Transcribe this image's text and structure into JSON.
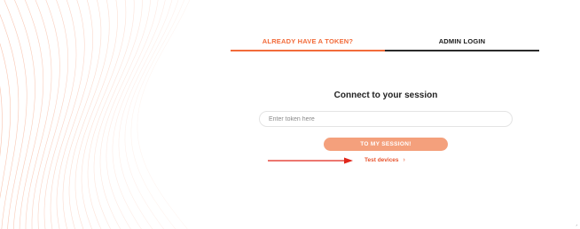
{
  "tabs": {
    "token_label": "ALREADY HAVE A TOKEN?",
    "admin_label": "ADMIN LOGIN"
  },
  "session": {
    "heading": "Connect to your session",
    "token_placeholder": "Enter token here",
    "token_value": "",
    "submit_label": "TO MY SESSION!"
  },
  "links": {
    "test_devices_label": "Test devices",
    "test_devices_chevron": "›"
  },
  "colors": {
    "accent": "#f26b3a",
    "button": "#f4a07c",
    "arrow": "#e0261b",
    "deco_lines": "#f7b49a"
  }
}
